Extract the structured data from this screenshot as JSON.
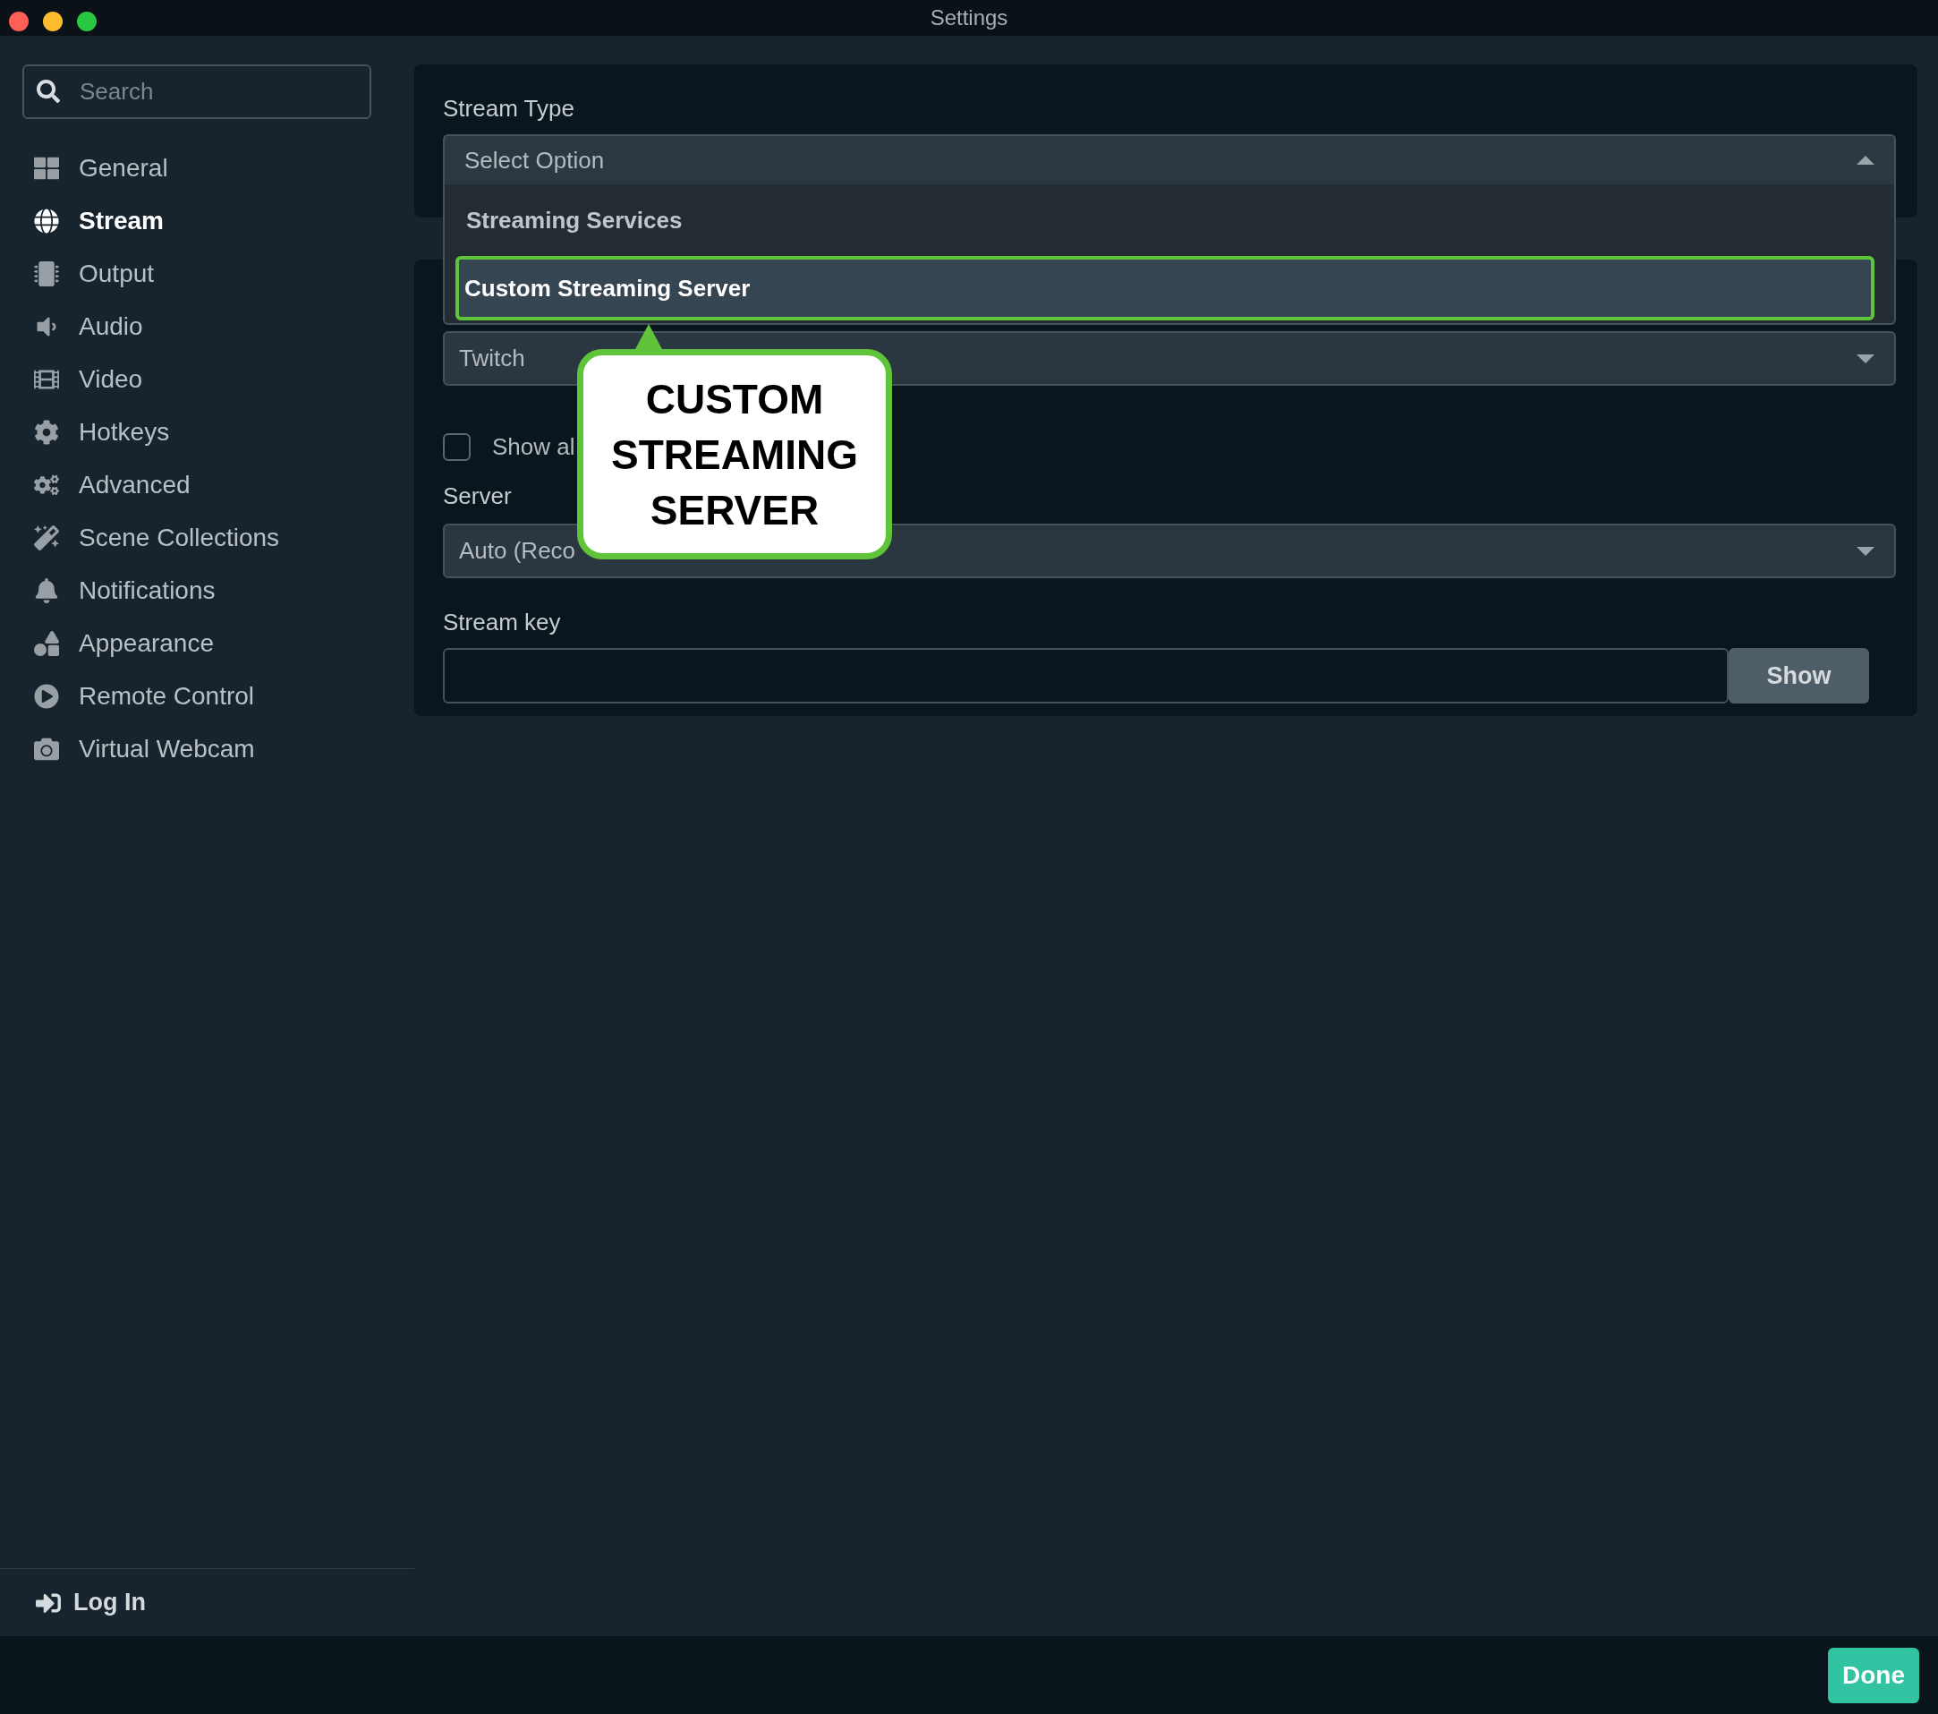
{
  "window": {
    "title": "Settings"
  },
  "sidebar": {
    "search": {
      "placeholder": "Search"
    },
    "items": [
      {
        "label": "General",
        "selected": false
      },
      {
        "label": "Stream",
        "selected": true
      },
      {
        "label": "Output",
        "selected": false
      },
      {
        "label": "Audio",
        "selected": false
      },
      {
        "label": "Video",
        "selected": false
      },
      {
        "label": "Hotkeys",
        "selected": false
      },
      {
        "label": "Advanced",
        "selected": false
      },
      {
        "label": "Scene Collections",
        "selected": false
      },
      {
        "label": "Notifications",
        "selected": false
      },
      {
        "label": "Appearance",
        "selected": false
      },
      {
        "label": "Remote Control",
        "selected": false
      },
      {
        "label": "Virtual Webcam",
        "selected": false
      }
    ],
    "login": "Log In"
  },
  "stream_type": {
    "label": "Stream Type",
    "value": "Select Option",
    "expanded": true,
    "options": [
      {
        "kind": "header",
        "label": "Streaming Services"
      },
      {
        "kind": "option",
        "label": "Custom Streaming Server",
        "selected": true
      }
    ]
  },
  "service": {
    "value": "Twitch"
  },
  "show_all": {
    "label": "Show al",
    "checked": false
  },
  "server": {
    "label": "Server",
    "value": "Auto (Reco"
  },
  "stream_key": {
    "label": "Stream key",
    "button": "Show"
  },
  "callout": {
    "text": "CUSTOM STREAMING SERVER"
  },
  "footer": {
    "done": "Done"
  }
}
